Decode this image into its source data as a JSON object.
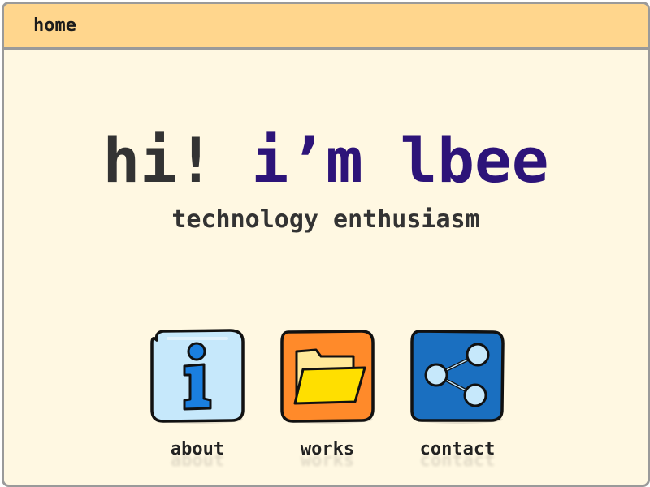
{
  "window": {
    "title": "home"
  },
  "hero": {
    "greeting": "hi!",
    "name": "i’m lbee",
    "tagline": "technology enthusiasm"
  },
  "apps": [
    {
      "label": "about",
      "icon": "info-icon",
      "color": "#c6e8fb"
    },
    {
      "label": "works",
      "icon": "folder-icon",
      "color": "#ff8a2a"
    },
    {
      "label": "contact",
      "icon": "share-icon",
      "color": "#1a6fc0"
    }
  ],
  "colors": {
    "background": "#fff8e2",
    "titlebar": "#ffd68d",
    "heading_dark": "#333333",
    "heading_accent": "#2d1479"
  }
}
